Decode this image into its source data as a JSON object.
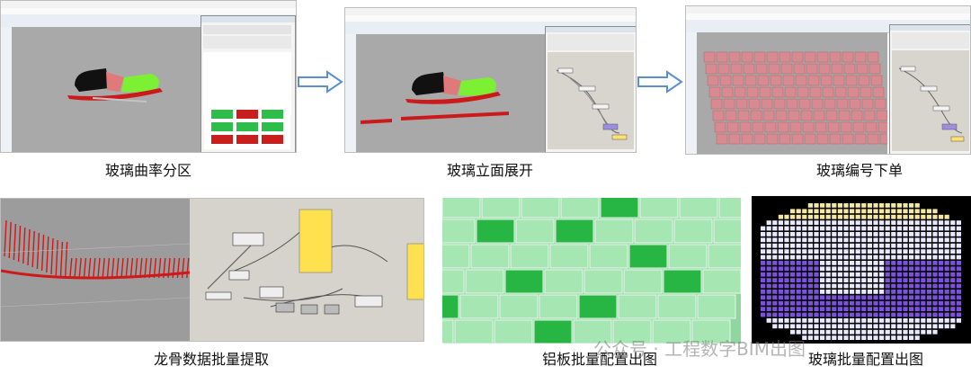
{
  "captions": {
    "c1": "玻璃曲率分区",
    "c2": "玻璃立面展开",
    "c3": "玻璃编号下单",
    "c4": "龙骨数据批量提取",
    "c5": "铝板批量配置出图",
    "c6": "玻璃批量配置出图"
  },
  "watermark": {
    "text": "公众号 · 工程数字BIM出图"
  },
  "colors": {
    "rhino_viewport": "#a9a9a9",
    "glass_green": "#2ebd4a",
    "glass_red": "#c81e1e",
    "arrow_blue": "#5a8fd0",
    "panel_pink": "#d98a91",
    "alu_light": "#a6e6b2",
    "alu_dark": "#27b544",
    "grid_purple": "#7b52d9"
  },
  "icons": {
    "arrow1": "right-arrow-icon",
    "arrow2": "right-arrow-icon"
  }
}
